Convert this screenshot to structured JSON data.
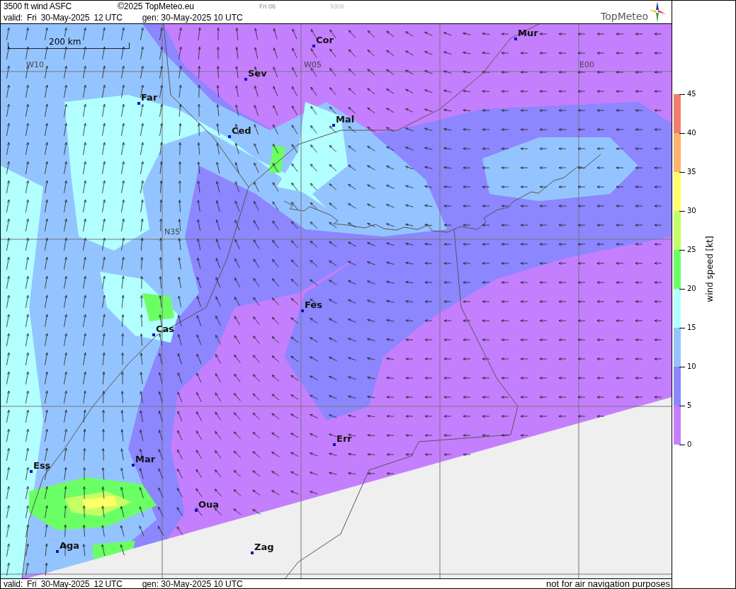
{
  "header": {
    "title": "3500 ft wind ASFC",
    "copyright": "©2025 TopMeteo.eu",
    "day_code": "Fri 06",
    "run_code": "9306",
    "valid": "valid:  Fri  30-May-2025  12 UTC",
    "generated": "gen: 30-May-2025 10 UTC",
    "logo_text": "TopMeteo"
  },
  "map": {
    "scale_label": "200 km",
    "grid_labels": [
      "W10",
      "W05",
      "E00",
      "N35"
    ],
    "cities": [
      {
        "name": "Cor"
      },
      {
        "name": "Mur"
      },
      {
        "name": "Sev"
      },
      {
        "name": "Far"
      },
      {
        "name": "Mal"
      },
      {
        "name": "Ced"
      },
      {
        "name": "Fes"
      },
      {
        "name": "Cas"
      },
      {
        "name": "Err"
      },
      {
        "name": "Mar"
      },
      {
        "name": "Ess"
      },
      {
        "name": "Oua"
      },
      {
        "name": "Aga"
      },
      {
        "name": "Zag"
      }
    ]
  },
  "legend": {
    "title": "wind  speed  [kt]",
    "bands": [
      {
        "color": "#f07f6a"
      },
      {
        "color": "#ffb26b"
      },
      {
        "color": "#ffff66"
      },
      {
        "color": "#c4ff66"
      },
      {
        "color": "#6bff66"
      },
      {
        "color": "#b2ffff"
      },
      {
        "color": "#94c4ff"
      },
      {
        "color": "#8c86ff"
      },
      {
        "color": "#c47fff"
      }
    ],
    "ticks": [
      "45",
      "40",
      "35",
      "30",
      "25",
      "20",
      "15",
      "10",
      "5",
      "0"
    ]
  },
  "footer": {
    "valid": "valid:  Fri  30-May-2025  12 UTC",
    "generated": "gen: 30-May-2025 10 UTC",
    "disclaimer": "not for air navigation purposes"
  }
}
